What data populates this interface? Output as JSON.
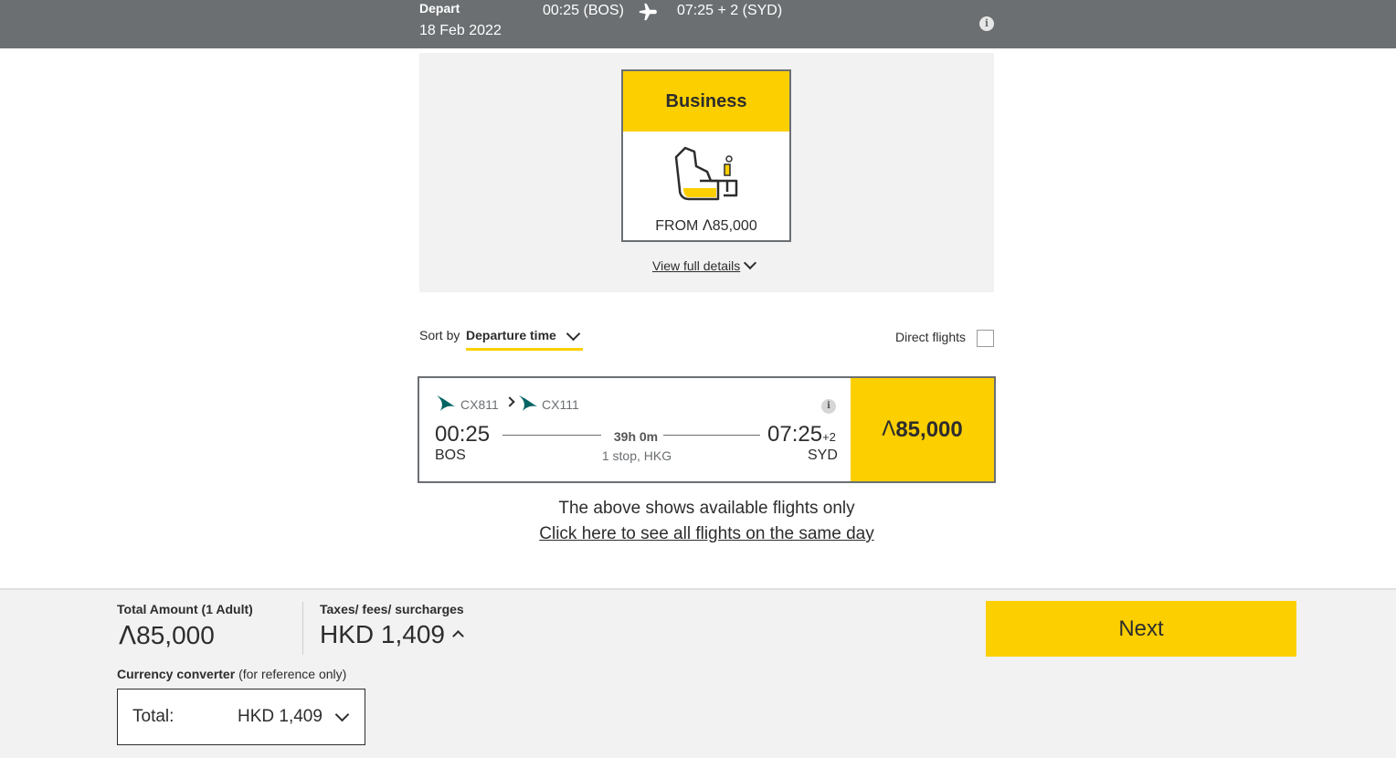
{
  "top_bar": {
    "depart_label": "Depart",
    "date": "18 Feb 2022",
    "departure_time": "00:25 (BOS)",
    "arrival_time": "07:25 + 2 (SYD)"
  },
  "cabin": {
    "name": "Business",
    "from_label": "FROM",
    "currency_symbol": "Λ",
    "price": "85,000",
    "view_details_label": "View full details"
  },
  "sort": {
    "label": "Sort by",
    "value": "Departure time"
  },
  "filter": {
    "direct_flights_label": "Direct flights",
    "direct_flights_checked": false
  },
  "flight": {
    "segments": [
      "CX811",
      "CX111"
    ],
    "depart_time": "00:25",
    "depart_code": "BOS",
    "arrive_time": "07:25",
    "arrive_day_offset": "+2",
    "arrive_code": "SYD",
    "duration": "39h 0m",
    "stops": "1 stop, HKG",
    "currency_symbol": "Λ",
    "price": "85,000"
  },
  "notes": {
    "available_only": "The above shows available flights only",
    "all_flights_link": "Click here to see all flights on the same day"
  },
  "footer": {
    "total_label": "Total Amount (1 Adult)",
    "currency_symbol": "Λ",
    "total_value": "85,000",
    "tax_label": "Taxes/ fees/ surcharges",
    "tax_value": "HKD 1,409",
    "converter_label": "Currency converter",
    "converter_note": "(for reference only)",
    "converter_total_label": "Total:",
    "converter_total_value": "HKD 1,409",
    "next_label": "Next"
  },
  "colors": {
    "accent_yellow": "#fccf00",
    "header_gray": "#6b6f72",
    "brand_teal": "#006564"
  },
  "icons": [
    "airplane-icon",
    "info-icon",
    "business-seat-icon",
    "chevron-down-icon",
    "cathay-logo-icon",
    "chevron-right-icon",
    "chevron-up-icon"
  ]
}
